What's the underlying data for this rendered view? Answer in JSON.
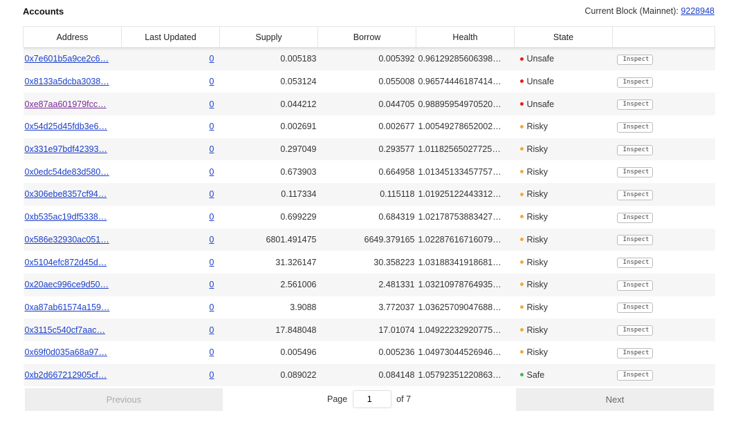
{
  "header": {
    "title": "Accounts",
    "block_label": "Current Block (Mainnet): ",
    "block_number": "9228948"
  },
  "table": {
    "columns": [
      "Address",
      "Last Updated",
      "Supply",
      "Borrow",
      "Health",
      "State",
      ""
    ],
    "inspect_label": "Inspect",
    "state_colors": {
      "Unsafe": "#e0201c",
      "Risky": "#f2a93b",
      "Safe": "#3cba54"
    },
    "rows": [
      {
        "address": "0x7e601b5a9ce2c6…",
        "last_updated": "0",
        "supply": "0.005183",
        "borrow": "0.005392",
        "health": "0.96129285606398…",
        "state": "Unsafe"
      },
      {
        "address": "0x8133a5dcba3038…",
        "last_updated": "0",
        "supply": "0.053124",
        "borrow": "0.055008",
        "health": "0.96574446187414…",
        "state": "Unsafe"
      },
      {
        "address": "0xe87aa601979fcc…",
        "last_updated": "0",
        "supply": "0.044212",
        "borrow": "0.044705",
        "health": "0.98895954970520…",
        "state": "Unsafe",
        "visited": true
      },
      {
        "address": "0x54d25d45fdb3e6…",
        "last_updated": "0",
        "supply": "0.002691",
        "borrow": "0.002677",
        "health": "1.00549278652002…",
        "state": "Risky"
      },
      {
        "address": "0x331e97bdf42393…",
        "last_updated": "0",
        "supply": "0.297049",
        "borrow": "0.293577",
        "health": "1.01182565027725…",
        "state": "Risky"
      },
      {
        "address": "0x0edc54de83d580…",
        "last_updated": "0",
        "supply": "0.673903",
        "borrow": "0.664958",
        "health": "1.01345133457757…",
        "state": "Risky"
      },
      {
        "address": "0x306ebe8357cf94…",
        "last_updated": "0",
        "supply": "0.117334",
        "borrow": "0.115118",
        "health": "1.01925122443312…",
        "state": "Risky"
      },
      {
        "address": "0xb535ac19df5338…",
        "last_updated": "0",
        "supply": "0.699229",
        "borrow": "0.684319",
        "health": "1.02178753883427…",
        "state": "Risky"
      },
      {
        "address": "0x586e32930ac051…",
        "last_updated": "0",
        "supply": "6801.491475",
        "borrow": "6649.379165",
        "health": "1.02287616716079…",
        "state": "Risky"
      },
      {
        "address": "0x5104efc872d45d…",
        "last_updated": "0",
        "supply": "31.326147",
        "borrow": "30.358223",
        "health": "1.03188341918681…",
        "state": "Risky"
      },
      {
        "address": "0x20aec996ce9d50…",
        "last_updated": "0",
        "supply": "2.561006",
        "borrow": "2.481331",
        "health": "1.03210978764935…",
        "state": "Risky"
      },
      {
        "address": "0xa87ab61574a159…",
        "last_updated": "0",
        "supply": "3.9088",
        "borrow": "3.772037",
        "health": "1.03625709047688…",
        "state": "Risky"
      },
      {
        "address": "0x3115c540cf7aac…",
        "last_updated": "0",
        "supply": "17.848048",
        "borrow": "17.01074",
        "health": "1.04922232920775…",
        "state": "Risky"
      },
      {
        "address": "0x69f0d035a68a97…",
        "last_updated": "0",
        "supply": "0.005496",
        "borrow": "0.005236",
        "health": "1.04973044526946…",
        "state": "Risky"
      },
      {
        "address": "0xb2d667212905cf…",
        "last_updated": "0",
        "supply": "0.089022",
        "borrow": "0.084148",
        "health": "1.05792351220863…",
        "state": "Safe"
      }
    ]
  },
  "pagination": {
    "previous_label": "Previous",
    "next_label": "Next",
    "page_label": "Page",
    "current_page": "1",
    "of_label": "of 7"
  }
}
